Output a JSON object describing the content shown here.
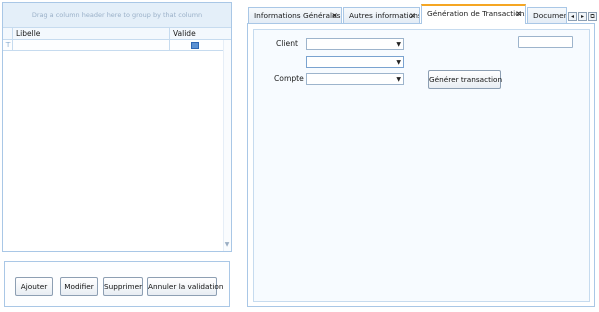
{
  "grid": {
    "group_hint": "Drag a column header here to group by that column",
    "columns": [
      "Libelle",
      "Valide"
    ],
    "filter_icon": "filter-icon",
    "filter_checkbox_state": "indeterminate"
  },
  "buttons": {
    "ajouter": "Ajouter",
    "modifier": "Modifier",
    "supprimer": "Supprimer",
    "annuler": "Annuler la validation"
  },
  "tabs": [
    {
      "label": "Informations Générales",
      "closable": true,
      "active": false
    },
    {
      "label": "Autres informations",
      "closable": true,
      "active": false
    },
    {
      "label": "Génération de Transactions",
      "closable": true,
      "active": true
    },
    {
      "label": "Documen",
      "closable": false,
      "active": false
    }
  ],
  "tab_close_glyph": "×",
  "tab_nav": {
    "left": "◂",
    "right": "▸",
    "list": "⧉"
  },
  "form": {
    "client_label": "Client",
    "compte_label": "Compte",
    "client_value": "",
    "second_value": "",
    "compte_value": "",
    "right_field_value": "",
    "generate_button": "Générer transaction"
  },
  "colors": {
    "accent_active_tab": "#f5a623",
    "border": "#a9c7e6",
    "panel_bg": "#f7fbff"
  }
}
